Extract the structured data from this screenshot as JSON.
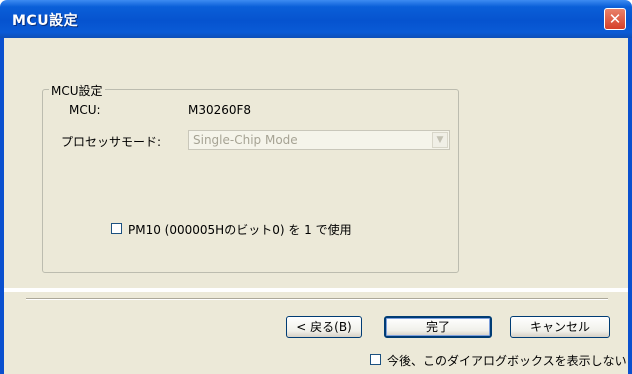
{
  "window": {
    "title": "MCU設定",
    "close_glyph": "✕"
  },
  "group": {
    "legend": "MCU設定",
    "mcu_label": "MCU:",
    "mcu_value": "M30260F8",
    "processor_mode_label": "プロセッサモード:",
    "processor_mode_value": "Single-Chip Mode",
    "pm10_label": "PM10 (000005Hのビット0) を 1 で使用",
    "pm10_checked": false
  },
  "footer": {
    "back_button": "< 戻る(B)",
    "finish_button": "完了",
    "cancel_button": "キャンセル",
    "dont_show_label": "今後、このダイアログボックスを表示しない",
    "dont_show_checked": false
  },
  "colors": {
    "titlebar": "#0a5fd8",
    "dialog_bg": "#ece9d8",
    "close_button": "#d6402a"
  },
  "icons": {
    "close": "close-icon",
    "dropdown": "chevron-down-icon"
  }
}
